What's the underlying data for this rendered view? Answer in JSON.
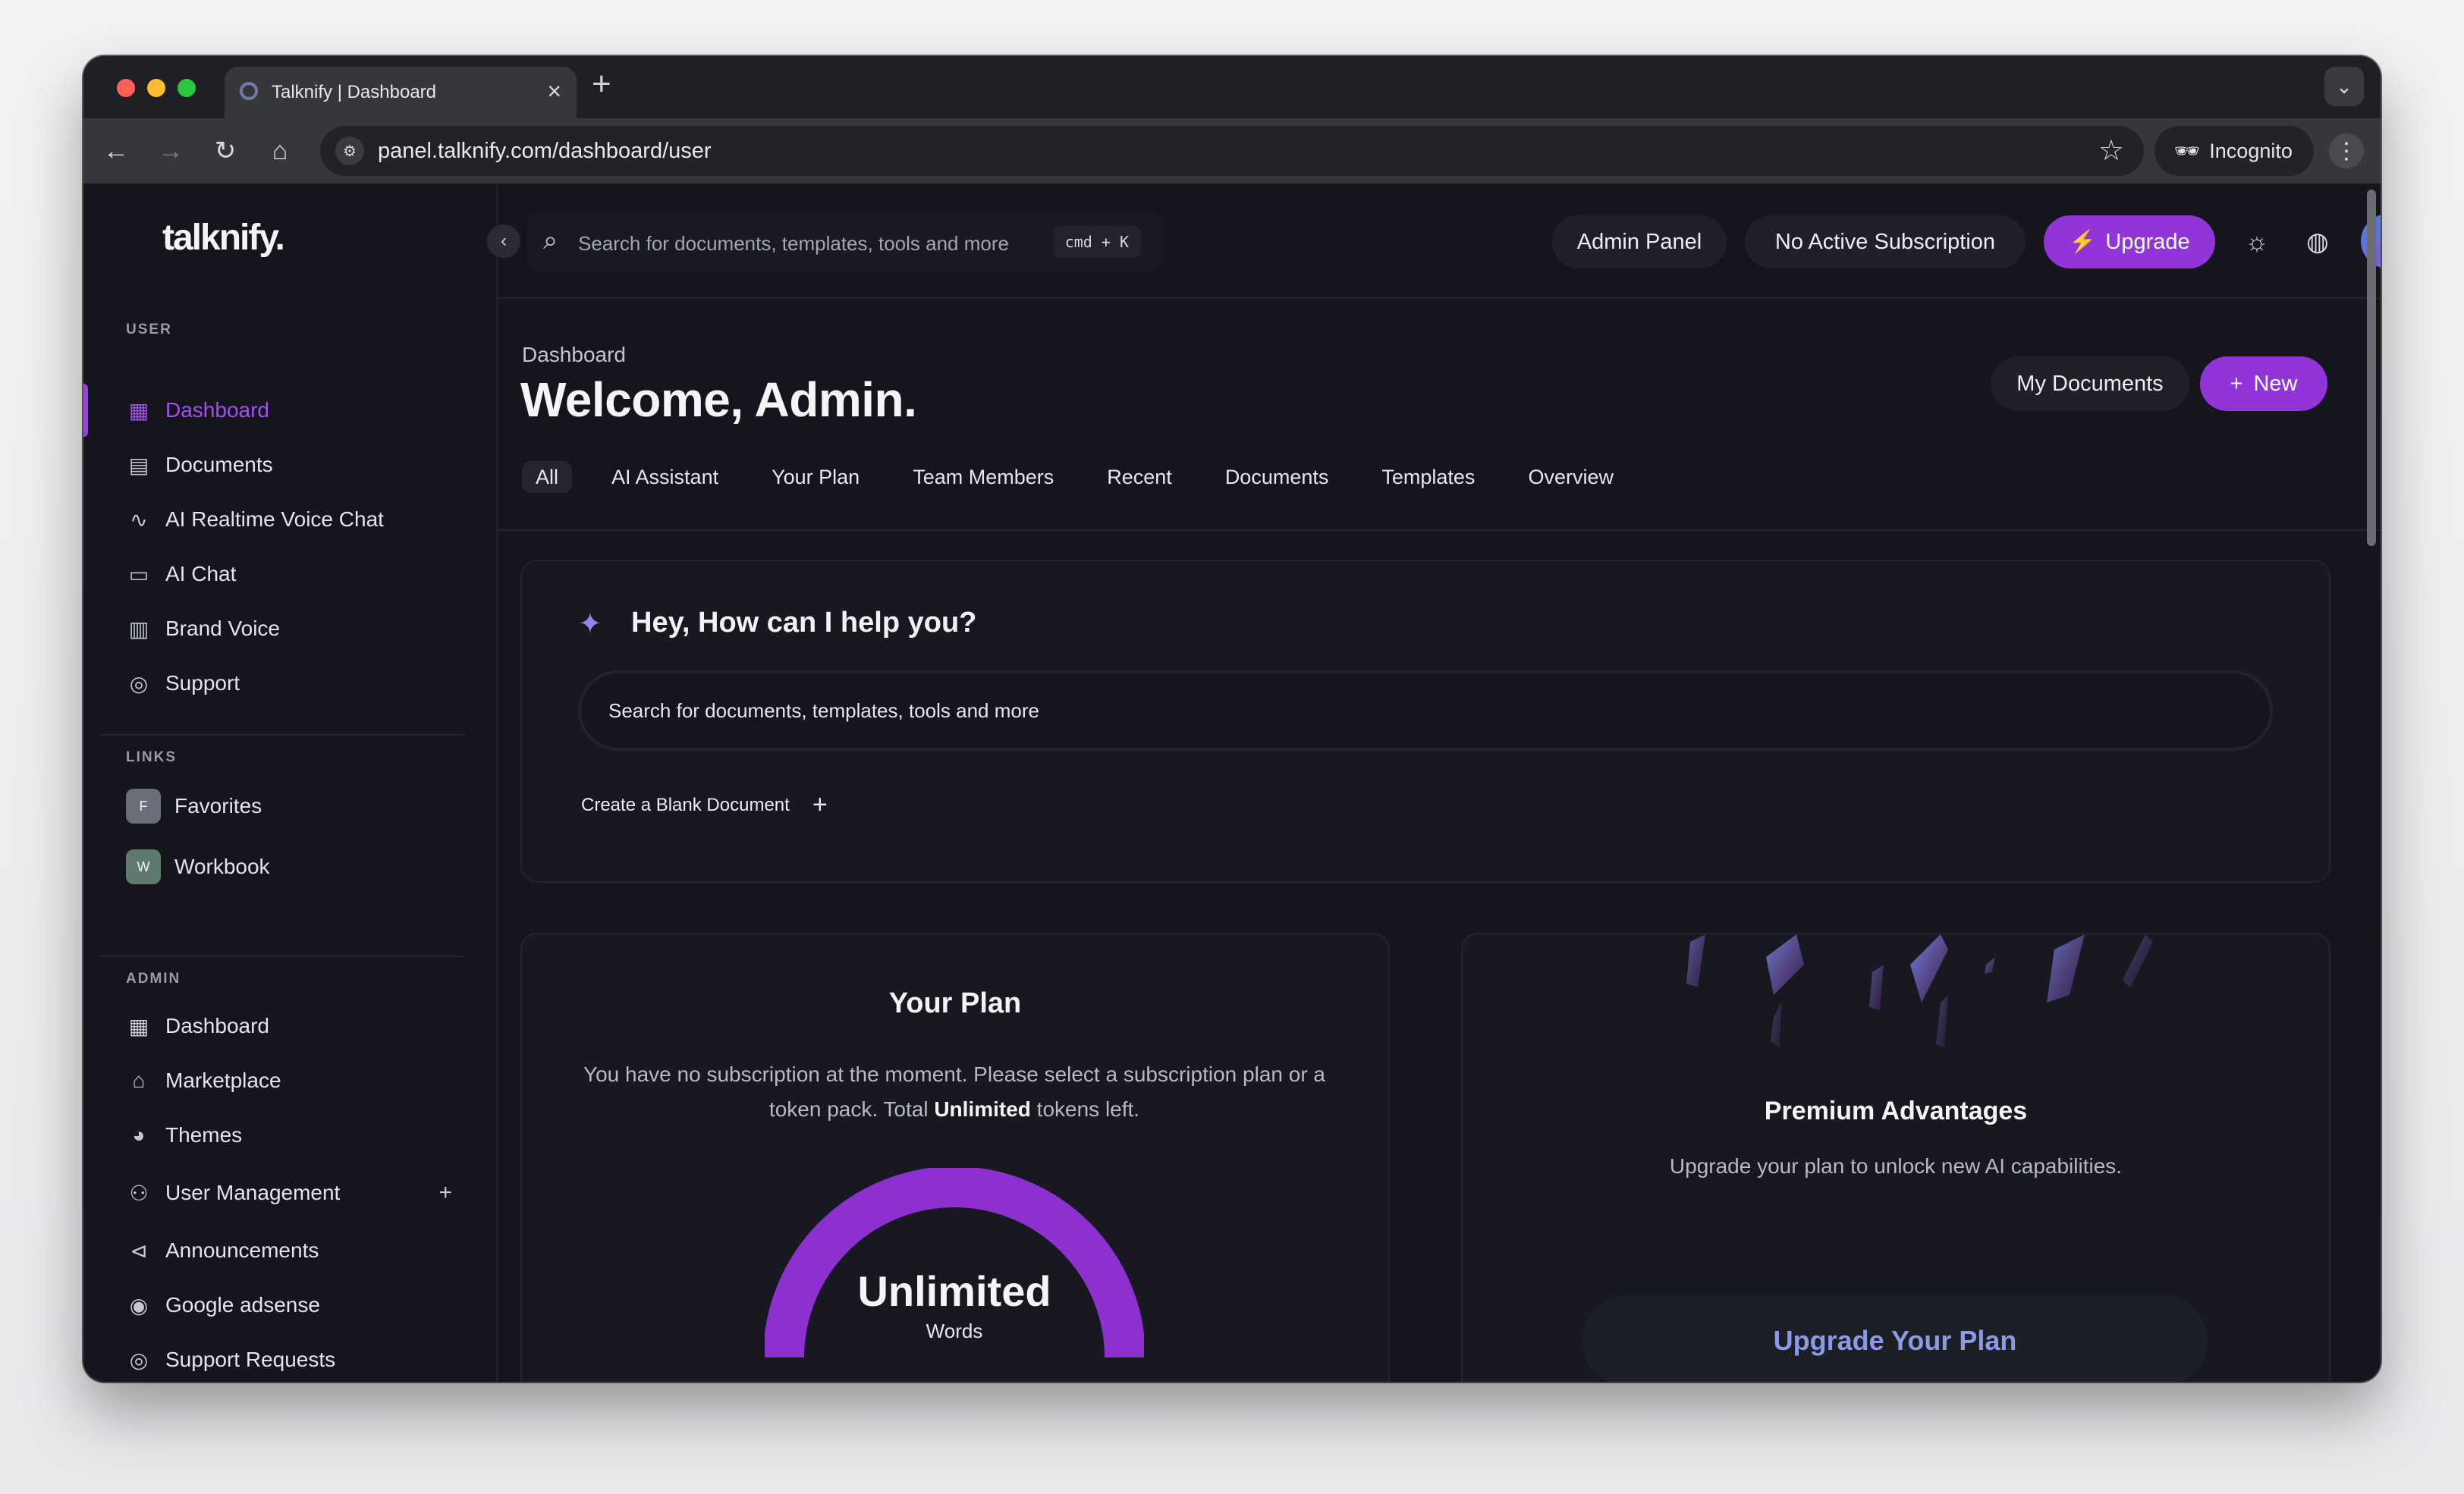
{
  "browser": {
    "tab_title": "Talknify | Dashboard",
    "url": "panel.talknify.com/dashboard/user",
    "incognito_label": "Incognito",
    "traffic_lights": [
      "#ff5f57",
      "#febc2e",
      "#28c840"
    ]
  },
  "sidebar": {
    "logo": "talknify.",
    "user_section": "USER",
    "user_items": [
      {
        "label": "Dashboard",
        "icon": "grid-icon"
      },
      {
        "label": "Documents",
        "icon": "archive-icon"
      },
      {
        "label": "AI Realtime Voice Chat",
        "icon": "waveform-icon"
      },
      {
        "label": "AI Chat",
        "icon": "chat-icon"
      },
      {
        "label": "Brand Voice",
        "icon": "brand-icon"
      },
      {
        "label": "Support",
        "icon": "lifebuoy-icon"
      }
    ],
    "links_section": "LINKS",
    "links": [
      {
        "letter": "F",
        "label": "Favorites",
        "color": "#6b6d78"
      },
      {
        "letter": "W",
        "label": "Workbook",
        "color": "#5e7a6f"
      }
    ],
    "admin_section": "ADMIN",
    "admin_items": [
      {
        "label": "Dashboard",
        "icon": "grid-icon"
      },
      {
        "label": "Marketplace",
        "icon": "store-icon"
      },
      {
        "label": "Themes",
        "icon": "palette-icon"
      },
      {
        "label": "User Management",
        "icon": "users-icon"
      },
      {
        "label": "Announcements",
        "icon": "megaphone-icon"
      },
      {
        "label": "Google adsense",
        "icon": "ad-icon"
      },
      {
        "label": "Support Requests",
        "icon": "lifebuoy-icon"
      }
    ]
  },
  "topbar": {
    "search_placeholder": "Search for documents, templates, tools and more",
    "shortcut": "cmd + K",
    "admin_panel": "Admin Panel",
    "subscription": "No Active Subscription",
    "upgrade": "Upgrade"
  },
  "header": {
    "breadcrumb": "Dashboard",
    "title": "Welcome, Admin.",
    "my_documents": "My Documents",
    "new": "New"
  },
  "tabs": [
    "All",
    "AI Assistant",
    "Your Plan",
    "Team Members",
    "Recent",
    "Documents",
    "Templates",
    "Overview"
  ],
  "help": {
    "title": "Hey, How can I help you?",
    "input_placeholder": "Search for documents, templates, tools and more",
    "blank_doc": "Create a Blank Document"
  },
  "plan": {
    "title": "Your Plan",
    "desc_before": "You have no subscription at the moment. Please select a subscription plan or a token pack. Total",
    "desc_strong": "Unlimited",
    "desc_after": "tokens left.",
    "gauge_value": "Unlimited",
    "gauge_unit": "Words",
    "gauge_color": "#8e2fcf"
  },
  "premium": {
    "title": "Premium Advantages",
    "desc": "Upgrade your plan to unlock new AI capabilities.",
    "button": "Upgrade Your Plan"
  },
  "colors": {
    "accent": "#9135d8",
    "background": "#15161d"
  }
}
